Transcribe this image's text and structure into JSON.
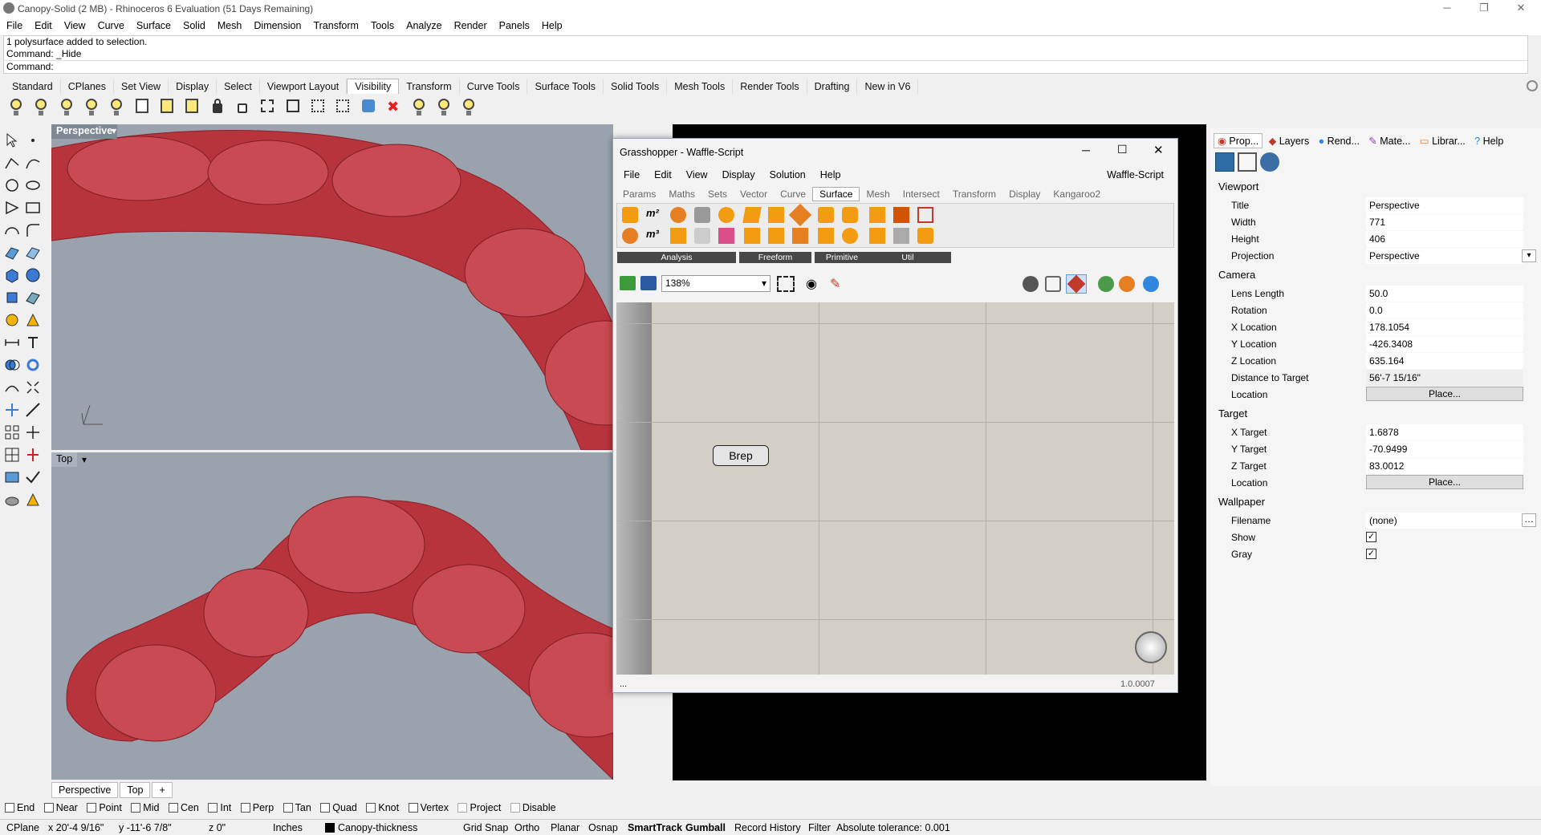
{
  "window": {
    "title": "Canopy-Solid (2 MB) - Rhinoceros 6 Evaluation (51 Days Remaining)"
  },
  "menu": [
    "File",
    "Edit",
    "View",
    "Curve",
    "Surface",
    "Solid",
    "Mesh",
    "Dimension",
    "Transform",
    "Tools",
    "Analyze",
    "Render",
    "Panels",
    "Help"
  ],
  "command": {
    "line1": "1 polysurface added to selection.",
    "line2": "Command: _Hide",
    "prompt": "Command:"
  },
  "toolbar_tabs": [
    "Standard",
    "CPlanes",
    "Set View",
    "Display",
    "Select",
    "Viewport Layout",
    "Visibility",
    "Transform",
    "Curve Tools",
    "Surface Tools",
    "Solid Tools",
    "Mesh Tools",
    "Render Tools",
    "Drafting",
    "New in V6"
  ],
  "active_toolbar_tab": "Visibility",
  "viewports": {
    "top_label": "Perspective",
    "bottom_label": "Top"
  },
  "viewport_tabs": [
    "Perspective",
    "Top"
  ],
  "osnaps": [
    "End",
    "Near",
    "Point",
    "Mid",
    "Cen",
    "Int",
    "Perp",
    "Tan",
    "Quad",
    "Knot",
    "Vertex",
    "Project",
    "Disable"
  ],
  "status": {
    "cplane": "CPlane",
    "x": "x 20'-4 9/16\"",
    "y": "y -11'-6 7/8\"",
    "z": "z 0\"",
    "units": "Inches",
    "layer": "Canopy-thickness",
    "grid_snap": "Grid Snap",
    "ortho": "Ortho",
    "planar": "Planar",
    "osnap": "Osnap",
    "smarttrack": "SmartTrack",
    "gumball": "Gumball",
    "record": "Record History",
    "filter": "Filter",
    "tolerance": "Absolute tolerance: 0.001"
  },
  "grasshopper": {
    "title": "Grasshopper - Waffle-Script",
    "doc": "Waffle-Script",
    "menu": [
      "File",
      "Edit",
      "View",
      "Display",
      "Solution",
      "Help"
    ],
    "tabs": [
      "Params",
      "Maths",
      "Sets",
      "Vector",
      "Curve",
      "Surface",
      "Mesh",
      "Intersect",
      "Transform",
      "Display",
      "Kangaroo2"
    ],
    "active_tab": "Surface",
    "groups": [
      "Analysis",
      "Freeform",
      "Primitive",
      "Util"
    ],
    "zoom": "138%",
    "component": "Brep",
    "version": "1.0.0007",
    "status_left": "..."
  },
  "properties": {
    "tabs": [
      "Prop...",
      "Layers",
      "Rend...",
      "Mate...",
      "Librar...",
      "Help"
    ],
    "viewport_header": "Viewport",
    "title_k": "Title",
    "title_v": "Perspective",
    "width_k": "Width",
    "width_v": "771",
    "height_k": "Height",
    "height_v": "406",
    "projection_k": "Projection",
    "projection_v": "Perspective",
    "camera_header": "Camera",
    "lens_k": "Lens Length",
    "lens_v": "50.0",
    "rot_k": "Rotation",
    "rot_v": "0.0",
    "xloc_k": "X Location",
    "xloc_v": "178.1054",
    "yloc_k": "Y Location",
    "yloc_v": "-426.3408",
    "zloc_k": "Z Location",
    "zloc_v": "635.164",
    "dist_k": "Distance to Target",
    "dist_v": "56'-7 15/16\"",
    "loc_k": "Location",
    "place": "Place...",
    "target_header": "Target",
    "xt_k": "X Target",
    "xt_v": "1.6878",
    "yt_k": "Y Target",
    "yt_v": "-70.9499",
    "zt_k": "Z Target",
    "zt_v": "83.0012",
    "loc2_k": "Location",
    "wall_header": "Wallpaper",
    "file_k": "Filename",
    "file_v": "(none)",
    "show_k": "Show",
    "gray_k": "Gray"
  }
}
